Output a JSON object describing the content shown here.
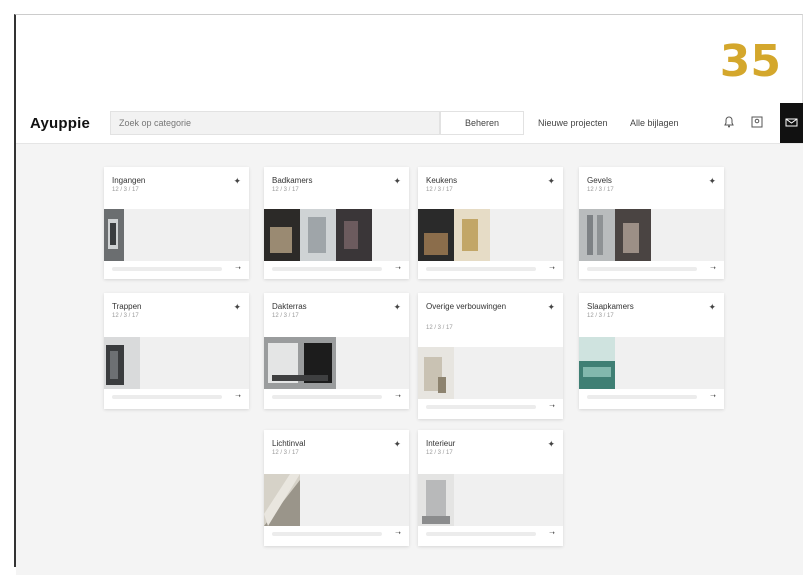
{
  "page_number": "35",
  "topbar": {
    "logo": "Ayuppie",
    "search_placeholder": "Zoek op categorie",
    "button_label": "Beheren",
    "link_1": "Nieuwe projecten",
    "link_2": "Alle bijlagen"
  },
  "cards": [
    {
      "title": "Ingangen",
      "sub": "12 / 3 / 17"
    },
    {
      "title": "Badkamers",
      "sub": "12 / 3 / 17"
    },
    {
      "title": "Keukens",
      "sub": "12 / 3 / 17"
    },
    {
      "title": "Gevels",
      "sub": "12 / 3 / 17"
    },
    {
      "title": "Trappen",
      "sub": "12 / 3 / 17"
    },
    {
      "title": "Dakterras",
      "sub": "12 / 3 / 17"
    },
    {
      "title": "Overige verbouwingen",
      "sub": "12 / 3 / 17"
    },
    {
      "title": "Slaapkamers",
      "sub": "12 / 3 / 17"
    },
    {
      "title": "Lichtinval",
      "sub": "12 / 3 / 17"
    },
    {
      "title": "Interieur",
      "sub": "12 / 3 / 17"
    }
  ],
  "icons": {
    "bell": "bell-icon",
    "user": "user-icon",
    "mode": "mail-icon",
    "card_menu": "pin-icon",
    "card_action": "arrow-icon"
  }
}
